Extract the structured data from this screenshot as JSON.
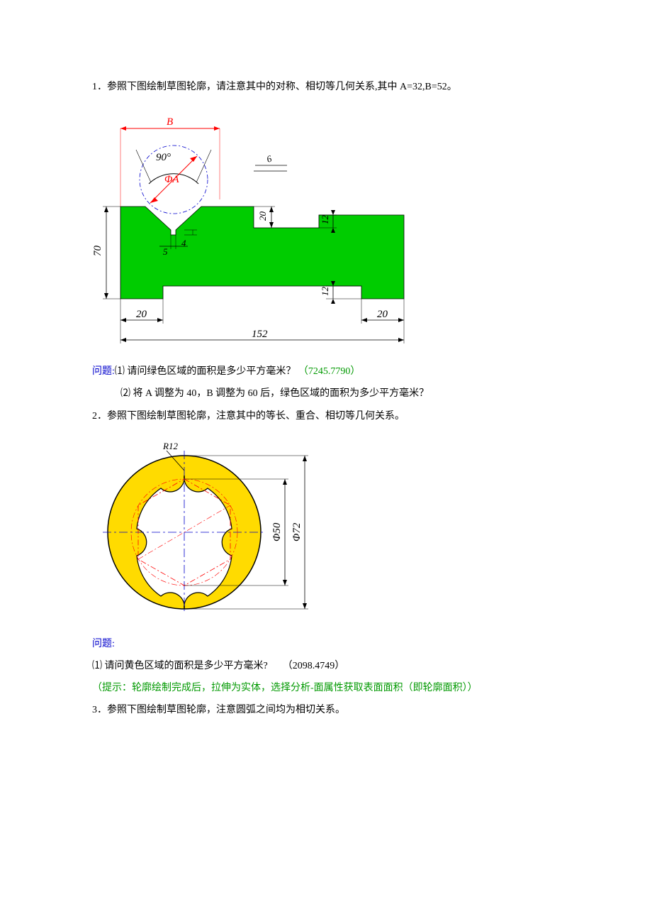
{
  "p1": {
    "num": "1．",
    "text": "参照下图绘制草图轮廓，请注意其中的对称、相切等几何关系,其中 A=32,B=52。",
    "dims": {
      "B": "B",
      "angle": "90°",
      "A_diam": "ΦA",
      "d6": "6",
      "d20": "20",
      "d12top": "12",
      "d70": "70",
      "d5": "5",
      "d4": "4",
      "d12bot": "12",
      "d20L": "20",
      "d152": "152",
      "d20R": "20"
    },
    "q_label": "问题:",
    "q1": "⑴ 请问绿色区域的面积是多少平方毫米？",
    "ans1": "（7245.7790）",
    "q2": "⑵ 将 A 调整为 40，B 调整为 60 后，绿色区域的面积为多少平方毫米？"
  },
  "p2": {
    "num": "2．",
    "text": "参照下图绘制草图轮廓，注意其中的等长、重合、相切等几何关系。",
    "dims": {
      "R12": "R12",
      "d50": "Φ50",
      "d72": "Φ72"
    },
    "q_label": "问题:",
    "q1": "⑴ 请问黄色区域的面积是多少平方毫米?",
    "ans1": "（2098.4749）",
    "hint": "（提示：轮廓绘制完成后，拉伸为实体，选择分析-面属性获取表面面积（即轮廓面积））"
  },
  "p3": {
    "num": "3．",
    "text": "参照下图绘制草图轮廓，注意圆弧之间均为相切关系。"
  }
}
